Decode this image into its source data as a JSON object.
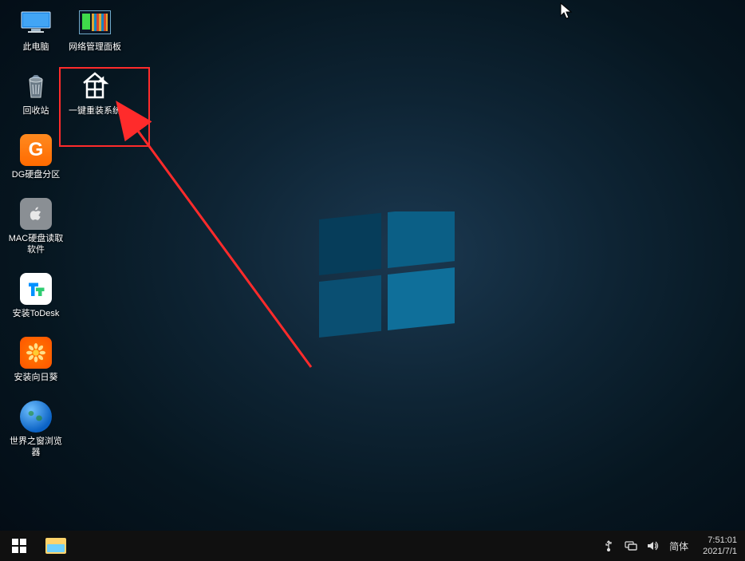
{
  "desktop": {
    "col1": [
      {
        "id": "this-pc",
        "label": "此电脑"
      },
      {
        "id": "recycle-bin",
        "label": "回收站"
      },
      {
        "id": "dg-partition",
        "label": "DG硬盘分区"
      },
      {
        "id": "mac-disk-read",
        "label": "MAC硬盘读取软件"
      },
      {
        "id": "install-todesk",
        "label": "安装ToDesk"
      },
      {
        "id": "install-sunflower",
        "label": "安装向日葵"
      },
      {
        "id": "world-window-browser",
        "label": "世界之窗浏览器"
      }
    ],
    "col2": [
      {
        "id": "network-panel",
        "label": "网络管理面板"
      },
      {
        "id": "one-click-reinstall",
        "label": "一键重装系统"
      }
    ]
  },
  "annotation": {
    "highlight_target": "one-click-reinstall",
    "highlight_color": "#ff2b2b",
    "arrow_color": "#ff2b2b"
  },
  "taskbar": {
    "apps": [
      "file-explorer"
    ],
    "ime": "简体",
    "time": "7:51:01",
    "date": "2021/7/1"
  }
}
